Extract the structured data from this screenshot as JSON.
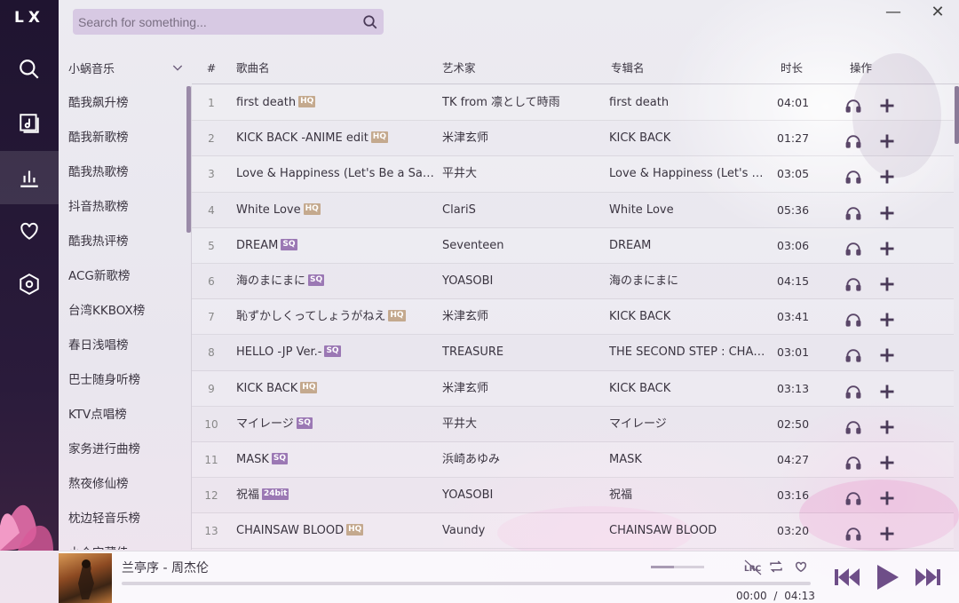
{
  "app": {
    "logo": "LX"
  },
  "search": {
    "placeholder": "Search for something..."
  },
  "window": {
    "minimize": "—",
    "close": "✕"
  },
  "nav": [
    {
      "name": "search-icon"
    },
    {
      "name": "music-library-icon"
    },
    {
      "name": "leaderboard-icon",
      "active": true
    },
    {
      "name": "heart-icon"
    },
    {
      "name": "settings-icon"
    }
  ],
  "sidebar": {
    "source": "小蜗音乐",
    "boards": [
      "酷我飙升榜",
      "酷我新歌榜",
      "酷我热歌榜",
      "抖音热歌榜",
      "酷我热评榜",
      "ACG新歌榜",
      "台湾KKBOX榜",
      "春日浅唱榜",
      "巴士随身听榜",
      "KTV点唱榜",
      "家务进行曲榜",
      "熬夜修仙榜",
      "枕边轻音乐榜",
      "小众宝藏佳"
    ]
  },
  "table": {
    "headers": {
      "num": "#",
      "name": "歌曲名",
      "artist": "艺术家",
      "album": "专辑名",
      "duration": "时长",
      "ops": "操作"
    },
    "rows": [
      {
        "num": "1",
        "name": "first death",
        "quality": "HQ",
        "artist": "TK from 凛として時雨",
        "album": "first death",
        "duration": "04:01"
      },
      {
        "num": "2",
        "name": "KICK BACK -ANIME edit",
        "quality": "HQ",
        "artist": "米津玄师",
        "album": "KICK BACK",
        "duration": "01:27"
      },
      {
        "num": "3",
        "name": "Love & Happiness (Let's Be a San...",
        "quality": "",
        "artist": "平井大",
        "album": "Love & Happiness (Let's B...",
        "duration": "03:05"
      },
      {
        "num": "4",
        "name": "White Love",
        "quality": "HQ",
        "artist": "ClariS",
        "album": "White Love",
        "duration": "05:36"
      },
      {
        "num": "5",
        "name": "DREAM",
        "quality": "SQ",
        "artist": "Seventeen",
        "album": "DREAM",
        "duration": "03:06"
      },
      {
        "num": "6",
        "name": "海のまにまに",
        "quality": "SQ",
        "artist": "YOASOBI",
        "album": "海のまにまに",
        "duration": "04:15"
      },
      {
        "num": "7",
        "name": "恥ずかしくってしょうがねえ",
        "quality": "HQ",
        "artist": "米津玄师",
        "album": "KICK BACK",
        "duration": "03:41"
      },
      {
        "num": "8",
        "name": "HELLO -JP Ver.-",
        "quality": "SQ",
        "artist": "TREASURE",
        "album": "THE SECOND STEP : CHAP...",
        "duration": "03:01"
      },
      {
        "num": "9",
        "name": "KICK BACK",
        "quality": "HQ",
        "artist": "米津玄师",
        "album": "KICK BACK",
        "duration": "03:13"
      },
      {
        "num": "10",
        "name": "マイレージ",
        "quality": "SQ",
        "artist": "平井大",
        "album": "マイレージ",
        "duration": "02:50"
      },
      {
        "num": "11",
        "name": "MASK",
        "quality": "SQ",
        "artist": "浜崎あゆみ",
        "album": "MASK",
        "duration": "04:27"
      },
      {
        "num": "12",
        "name": "祝福",
        "quality": "24bit",
        "artist": "YOASOBI",
        "album": "祝福",
        "duration": "03:16"
      },
      {
        "num": "13",
        "name": "CHAINSAW BLOOD",
        "quality": "HQ",
        "artist": "Vaundy",
        "album": "CHAINSAW BLOOD",
        "duration": "03:20"
      }
    ]
  },
  "player": {
    "title": "兰亭序 - 周杰伦",
    "current_time": "00:00",
    "separator": "/",
    "total_time": "04:13",
    "progress": 0,
    "volume": 0.43,
    "lyric_label": "LRC"
  },
  "colors": {
    "accent": "#7a5a92",
    "hq_badge": "#c4a98e",
    "sq_badge": "#9b78b4",
    "rail": "#241735",
    "search_bg": "#d7c9e3"
  }
}
